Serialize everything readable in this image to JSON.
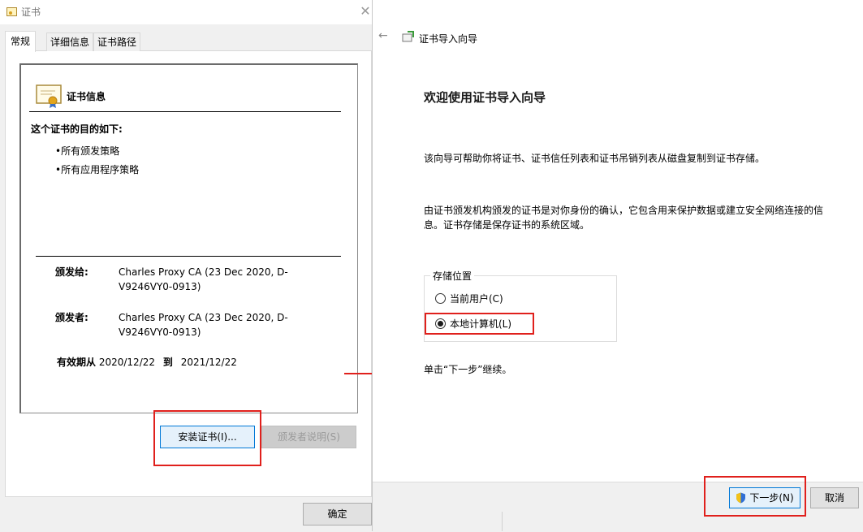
{
  "cert_dialog": {
    "title": "证书",
    "tabs": [
      "常规",
      "详细信息",
      "证书路径"
    ],
    "info_heading": "证书信息",
    "purpose_title": "这个证书的目的如下:",
    "purposes": [
      "•所有颁发策略",
      "•所有应用程序策略"
    ],
    "issued_to_label": "颁发给:",
    "issued_to_value": "Charles Proxy CA (23 Dec 2020, D-V9246VY0-0913)",
    "issued_by_label": "颁发者:",
    "issued_by_value": "Charles Proxy CA (23 Dec 2020, D-V9246VY0-0913)",
    "valid_from_label": "有效期从",
    "valid_from": "2020/12/22",
    "valid_to_label": "到",
    "valid_to": "2021/12/22",
    "install_button": "安装证书(I)...",
    "issuer_statement_button": "颁发者说明(S)",
    "ok_button": "确定"
  },
  "wizard": {
    "title": "证书导入向导",
    "heading": "欢迎使用证书导入向导",
    "desc1": "该向导可帮助你将证书、证书信任列表和证书吊销列表从磁盘复制到证书存储。",
    "desc2": "由证书颁发机构颁发的证书是对你身份的确认，它包含用来保护数据或建立安全网络连接的信息。证书存储是保存证书的系统区域。",
    "store_location_label": "存储位置",
    "options": [
      {
        "label": "当前用户(C)",
        "checked": false
      },
      {
        "label": "本地计算机(L)",
        "checked": true
      }
    ],
    "continue_text": "单击“下一步”继续。",
    "next_button": "下一步(N)",
    "cancel_button": "取消"
  },
  "colors": {
    "highlight": "#e0201c",
    "accent": "#0078d7"
  }
}
